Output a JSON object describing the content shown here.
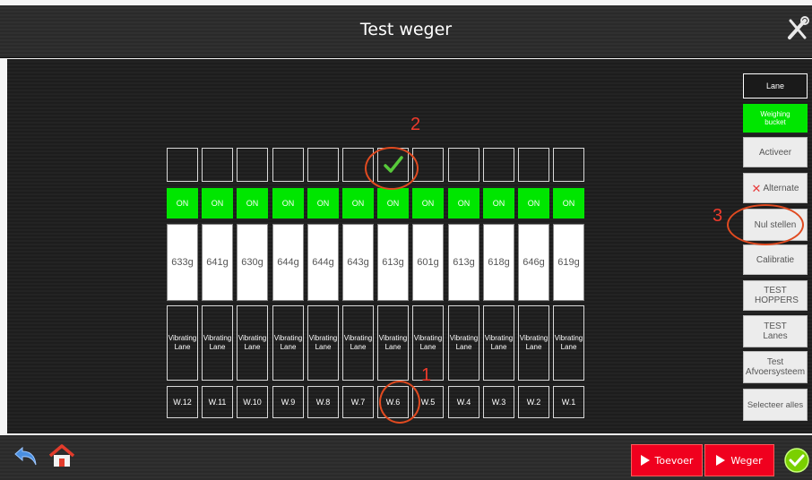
{
  "header": {
    "title": "Test weger"
  },
  "lanes": [
    {
      "status": "ON",
      "weight": "633g",
      "type": "Vibrating Lane",
      "label": "W.12",
      "checked": false
    },
    {
      "status": "ON",
      "weight": "641g",
      "type": "Vibrating Lane",
      "label": "W.11",
      "checked": false
    },
    {
      "status": "ON",
      "weight": "630g",
      "type": "Vibrating Lane",
      "label": "W.10",
      "checked": false
    },
    {
      "status": "ON",
      "weight": "644g",
      "type": "Vibrating Lane",
      "label": "W.9",
      "checked": false
    },
    {
      "status": "ON",
      "weight": "644g",
      "type": "Vibrating Lane",
      "label": "W.8",
      "checked": false
    },
    {
      "status": "ON",
      "weight": "643g",
      "type": "Vibrating Lane",
      "label": "W.7",
      "checked": false
    },
    {
      "status": "ON",
      "weight": "613g",
      "type": "Vibrating Lane",
      "label": "W.6",
      "checked": true
    },
    {
      "status": "ON",
      "weight": "601g",
      "type": "Vibrating Lane",
      "label": "W.5",
      "checked": false
    },
    {
      "status": "ON",
      "weight": "613g",
      "type": "Vibrating Lane",
      "label": "W.4",
      "checked": false
    },
    {
      "status": "ON",
      "weight": "618g",
      "type": "Vibrating Lane",
      "label": "W.3",
      "checked": false
    },
    {
      "status": "ON",
      "weight": "646g",
      "type": "Vibrating Lane",
      "label": "W.2",
      "checked": false
    },
    {
      "status": "ON",
      "weight": "619g",
      "type": "Vibrating Lane",
      "label": "W.1",
      "checked": false
    }
  ],
  "sidebar": {
    "lane": "Lane",
    "weighing_bucket": "Weighing bucket",
    "activeer": "Activeer",
    "alternate": "Alternate",
    "nul_stellen": "Nul stellen",
    "calibratie": "Calibratie",
    "test_hoppers": "TEST HOPPERS",
    "test_lanes": "TEST Lanes",
    "test_afvoer": "Test Afvoersysteem",
    "selecteer_alles": "Selecteer alles"
  },
  "footer": {
    "toevoer": "Toevoer",
    "weger": "Weger"
  },
  "annotations": {
    "one": "1",
    "two": "2",
    "three": "3"
  },
  "colors": {
    "on_green": "#00e600",
    "red_button": "#f0001e",
    "annotation": "#e04a20"
  }
}
